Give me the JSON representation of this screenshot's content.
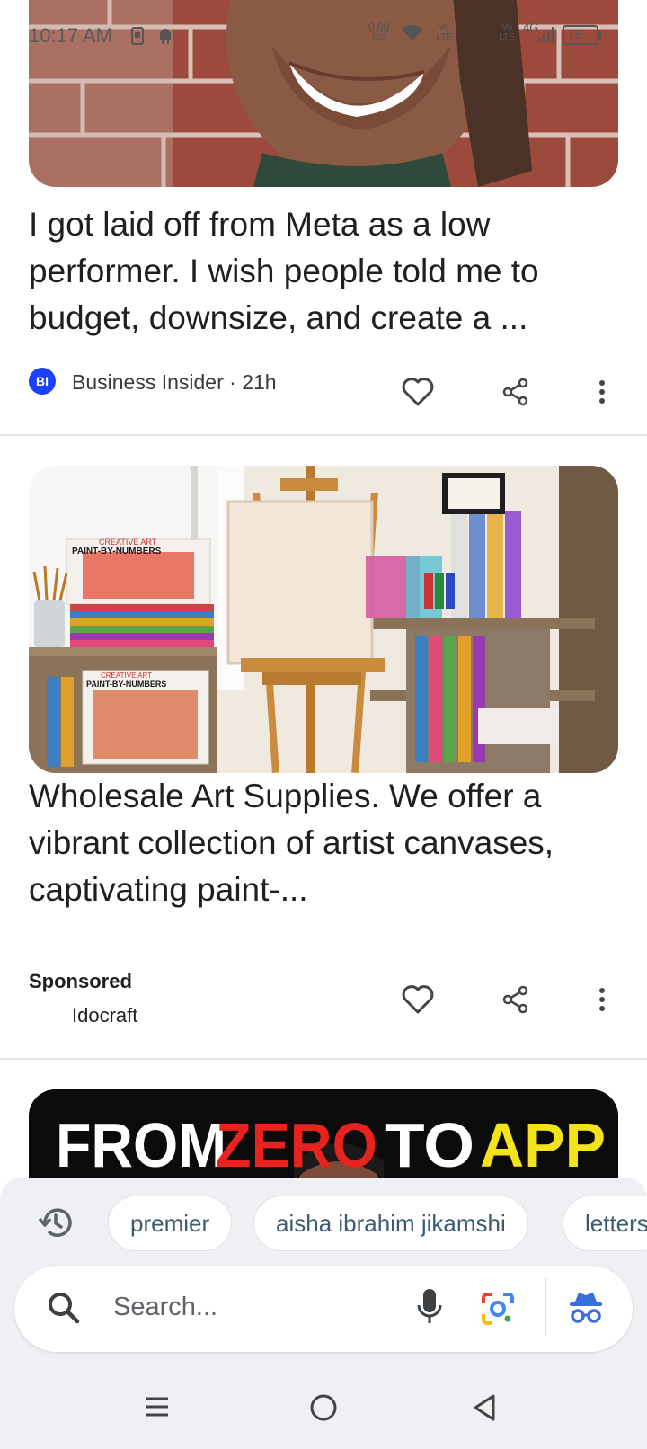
{
  "status_bar": {
    "time": "10:17 AM",
    "net_speed_value": "0.00",
    "net_speed_unit": "B/S",
    "volte1": "Vo LTE",
    "volte2": "Vo LTE",
    "network": "4G",
    "battery": "76"
  },
  "feed": {
    "article1": {
      "headline": "I got laid off from Meta as a low performer. I wish people told me to budget, downsize, and create a ...",
      "source_badge": "BI",
      "source_line": "Business Insider · 21h"
    },
    "ad": {
      "headline": "Wholesale Art Supplies. We offer a vibrant collection of artist canvases, captivating paint-...",
      "sponsored_label": "Sponsored",
      "advertiser": "Idocraft",
      "image_labels": [
        "CREATIVE ART",
        "PAINT-BY-NUMBERS",
        "CREATIVE ART",
        "PAINT-BY-NUMBERS"
      ]
    },
    "article3": {
      "image_text_1": "FROM",
      "image_text_2": "ZERO",
      "image_text_3": "TO",
      "image_text_4": "APP"
    }
  },
  "search_panel": {
    "chips": [
      "premier",
      "aisha ibrahim jikamshi",
      "letters"
    ],
    "placeholder": "Search..."
  },
  "colors": {
    "bi_blue": "#1a41ff",
    "chip_text": "#3d5a75",
    "panel_bg": "#eef0f3"
  },
  "icons": [
    "history-icon",
    "search-icon",
    "mic-icon",
    "google-lens-icon",
    "incognito-icon",
    "heart-icon",
    "share-icon",
    "more-vert-icon",
    "menu-icon",
    "home-circle-icon",
    "back-triangle-icon"
  ]
}
